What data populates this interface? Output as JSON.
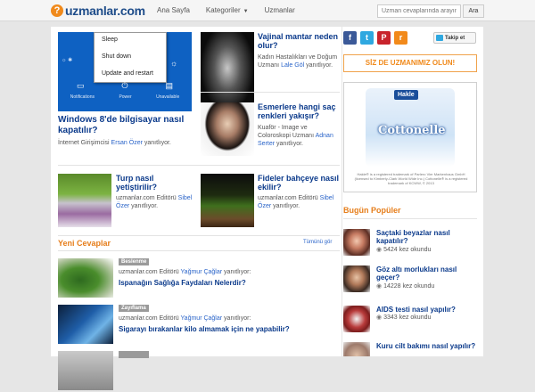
{
  "header": {
    "logo_mark": "?",
    "logo_text": "uzmanlar.com",
    "nav": [
      {
        "label": "Ana Sayfa"
      },
      {
        "label": "Kategoriler"
      },
      {
        "label": "Uzmanlar"
      }
    ],
    "search_placeholder": "Uzman cevaplarında arayın",
    "search_button": "Ara"
  },
  "featured": [
    {
      "title": "Windows 8'de bilgisayar nasıl kapatılır?",
      "author_title": "İnternet Girişimcisi",
      "author": "Ersan Özer",
      "suffix": "yanıtlıyor.",
      "image": {
        "menu": [
          "Sleep",
          "Shut down",
          "Update and restart"
        ],
        "labels": [
          "Notifications",
          "Power",
          "Unavailable"
        ]
      }
    },
    {
      "title": "Vajinal mantar neden olur?",
      "author_title": "Kadın Hastalıkları ve Doğum Uzmanı",
      "author": "Lale Göl",
      "suffix": "yanıtlıyor."
    },
    {
      "title": "Esmerlere hangi saç renkleri yakışır?",
      "author_title": "Kuaför - Image ve Coloroskopi Uzmanı",
      "author": "Adnan Serter",
      "suffix": "yanıtlıyor."
    },
    {
      "title": "Turp nasıl yetiştirilir?",
      "author_title": "uzmanlar.com Editörü",
      "author": "Sibel Özer",
      "suffix": "yanıtlıyor."
    },
    {
      "title": "Fideler bahçeye nasıl ekilir?",
      "author_title": "uzmanlar.com Editörü",
      "author": "Sibel Özer",
      "suffix": "yanıtlıyor."
    }
  ],
  "recent": {
    "heading": "Yeni Cevaplar",
    "see_all": "Tümünü gör",
    "items": [
      {
        "category": "Beslenme",
        "author_title": "uzmanlar.com Editörü",
        "author": "Yağmur Çağlar",
        "suffix": "yanıtlıyor:",
        "title": "Ispanağın Sağlığa Faydaları Nelerdir?"
      },
      {
        "category": "Zayıflama",
        "author_title": "uzmanlar.com Editörü",
        "author": "Yağmur Çağlar",
        "suffix": "yanıtlıyor:",
        "title": "Sigarayı bırakanlar kilo almamak için ne yapabilir?"
      }
    ]
  },
  "sidebar": {
    "social": [
      "f",
      "t",
      "P",
      "r"
    ],
    "follow": "Takip et",
    "cta": "SİZ DE UZMANIMIZ OLUN!",
    "ad": {
      "badge": "Hakle",
      "brand": "Cottonelle",
      "legal": "Hakle® is a registered trademark of Parlero Vier Markenhaus GmbH (licensed to Kimberly-Clark World Wide Inc.) Cottonelle® is a registered trademark of KCWW, © 2013"
    },
    "popular_heading": "Bugün Popüler",
    "popular": [
      {
        "title": "Saçtaki beyazlar nasıl kapatılır?",
        "views": "5424 kez okundu"
      },
      {
        "title": "Göz altı morlukları nasıl geçer?",
        "views": "14228 kez okundu"
      },
      {
        "title": "AIDS testi nasıl yapılır?",
        "views": "3343 kez okundu"
      },
      {
        "title": "Kuru cilt bakımı nasıl yapılır?",
        "views": ""
      }
    ]
  },
  "colors": {
    "brand_blue": "#0b3a8b",
    "accent_orange": "#e67e1b",
    "link_blue": "#2a64c9"
  }
}
